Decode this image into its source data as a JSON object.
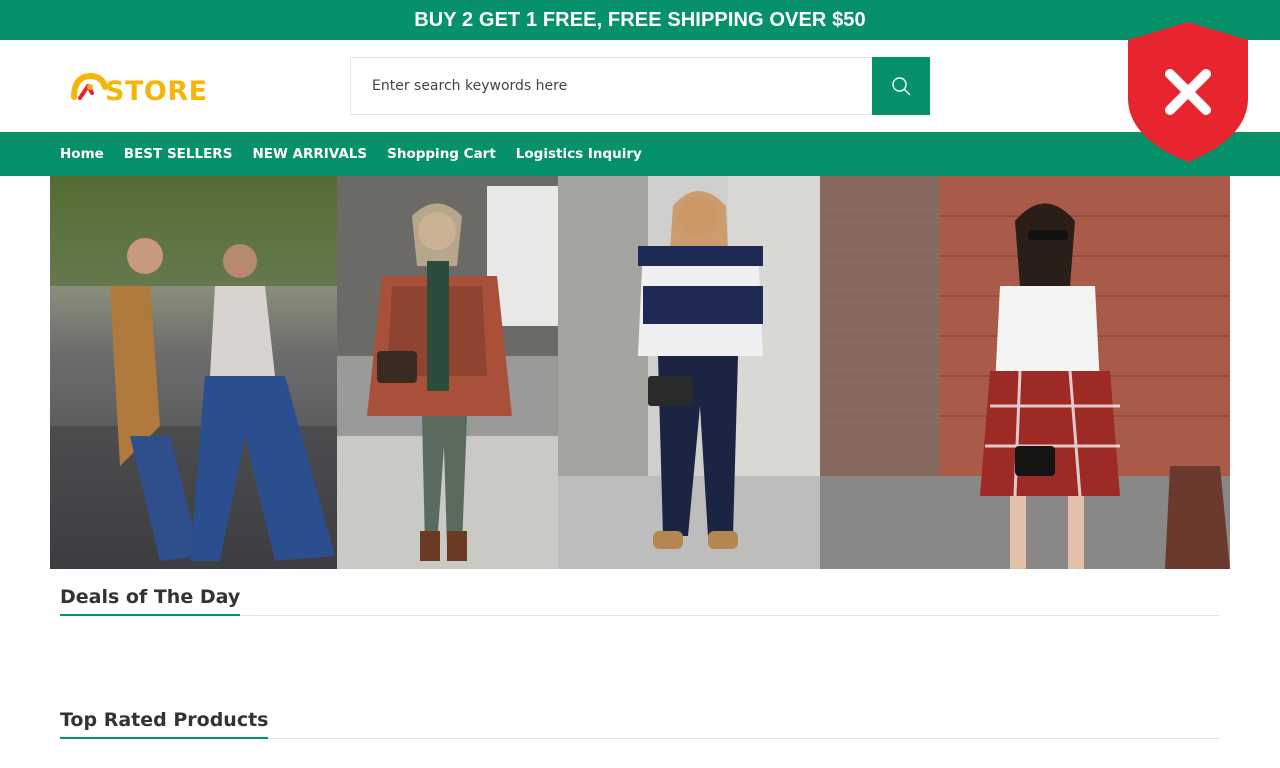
{
  "promo": {
    "text": "BUY 2 GET 1 FREE, FREE SHIPPING OVER $50"
  },
  "header": {
    "logo_text": "STORE",
    "search": {
      "placeholder": "Enter search keywords here",
      "value": ""
    }
  },
  "nav": {
    "items": [
      {
        "label": "Home"
      },
      {
        "label": "BEST SELLERS"
      },
      {
        "label": "NEW ARRIVALS"
      },
      {
        "label": "Shopping Cart"
      },
      {
        "label": "Logistics Inquiry"
      }
    ]
  },
  "badge": {
    "icon": "shield-x-icon",
    "color": "#e8242f"
  },
  "sections": {
    "deals_title": "Deals of The Day",
    "top_rated_title": "Top Rated Products"
  },
  "theme": {
    "accent": "#07916b",
    "logo_color": "#f5b60b"
  }
}
